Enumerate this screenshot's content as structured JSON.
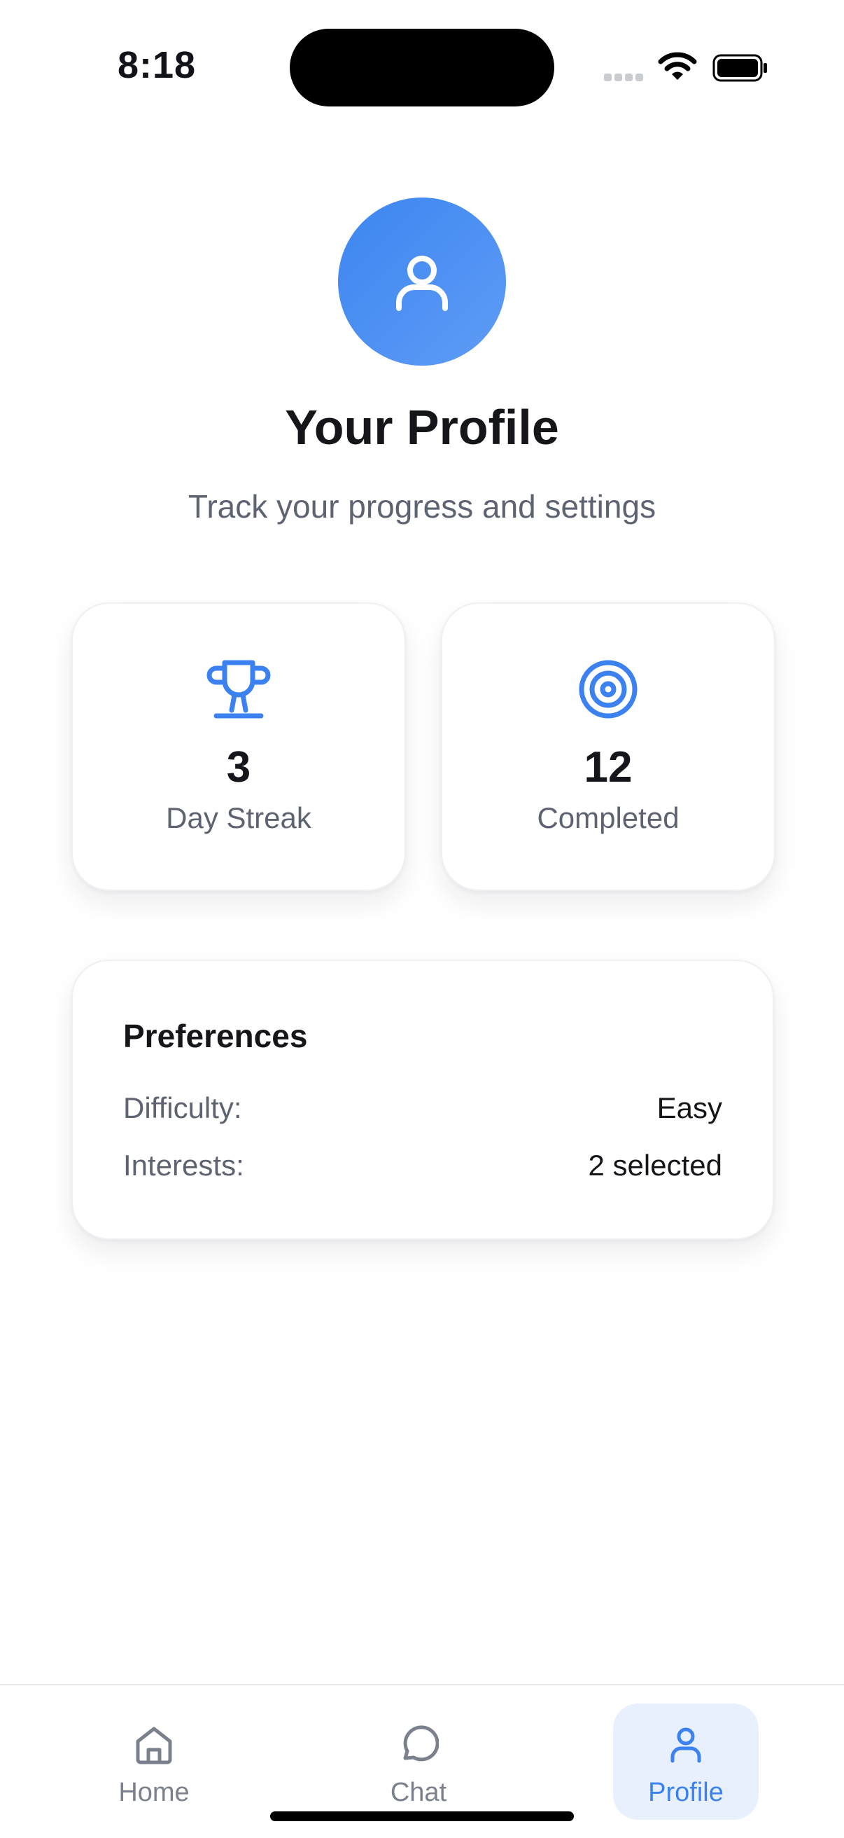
{
  "status_bar": {
    "time": "8:18"
  },
  "header": {
    "title": "Your Profile",
    "subtitle": "Track your progress and settings",
    "avatar_icon": "user-icon"
  },
  "stats": [
    {
      "icon": "trophy-icon",
      "value": "3",
      "label": "Day Streak"
    },
    {
      "icon": "target-icon",
      "value": "12",
      "label": "Completed"
    }
  ],
  "preferences": {
    "title": "Preferences",
    "rows": [
      {
        "key": "Difficulty:",
        "value": "Easy"
      },
      {
        "key": "Interests:",
        "value": "2 selected"
      }
    ]
  },
  "tab_bar": {
    "tabs": [
      {
        "label": "Home",
        "icon": "home-icon"
      },
      {
        "label": "Chat",
        "icon": "chat-icon"
      },
      {
        "label": "Profile",
        "icon": "user-icon",
        "active": true
      }
    ]
  },
  "colors": {
    "accent": "#3b82f0",
    "muted_text": "#5d6370",
    "active_tab_bg": "#e8f0fd"
  }
}
